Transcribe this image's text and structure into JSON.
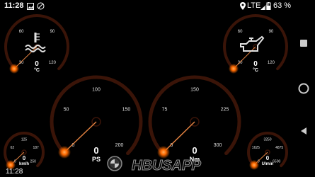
{
  "status": {
    "time": "11:28",
    "network": "LTE",
    "battery": "63 %"
  },
  "bottom_clock": "11:28",
  "logo_text": "HBUSAPP",
  "colors": {
    "arc": "#3a1408",
    "tick": "#e0e0e0",
    "needle": "#e08040",
    "glow": "#ff6a00"
  },
  "gauges": {
    "water": {
      "value": "0",
      "unit": "°C",
      "ticks": [
        "30",
        "60",
        "90",
        "120"
      ],
      "icon": "coolant-temperature-icon"
    },
    "oil": {
      "value": "0",
      "unit": "°C",
      "ticks": [
        "30",
        "60",
        "90",
        "120"
      ],
      "icon": "oil-can-icon"
    },
    "power": {
      "value": "0",
      "unit": "PS",
      "ticks": [
        "0",
        "50",
        "100",
        "150",
        "200"
      ]
    },
    "torque": {
      "value": "0",
      "unit": "Nm",
      "ticks": [
        "0",
        "75",
        "150",
        "225",
        "300"
      ]
    },
    "speed": {
      "value": "0",
      "unit": "km/h",
      "ticks": [
        "0",
        "62",
        "125",
        "187",
        "250"
      ]
    },
    "rpm": {
      "value": "0",
      "unit": "U/min",
      "ticks": [
        "0",
        "1625",
        "3250",
        "4875",
        "6500"
      ]
    }
  }
}
